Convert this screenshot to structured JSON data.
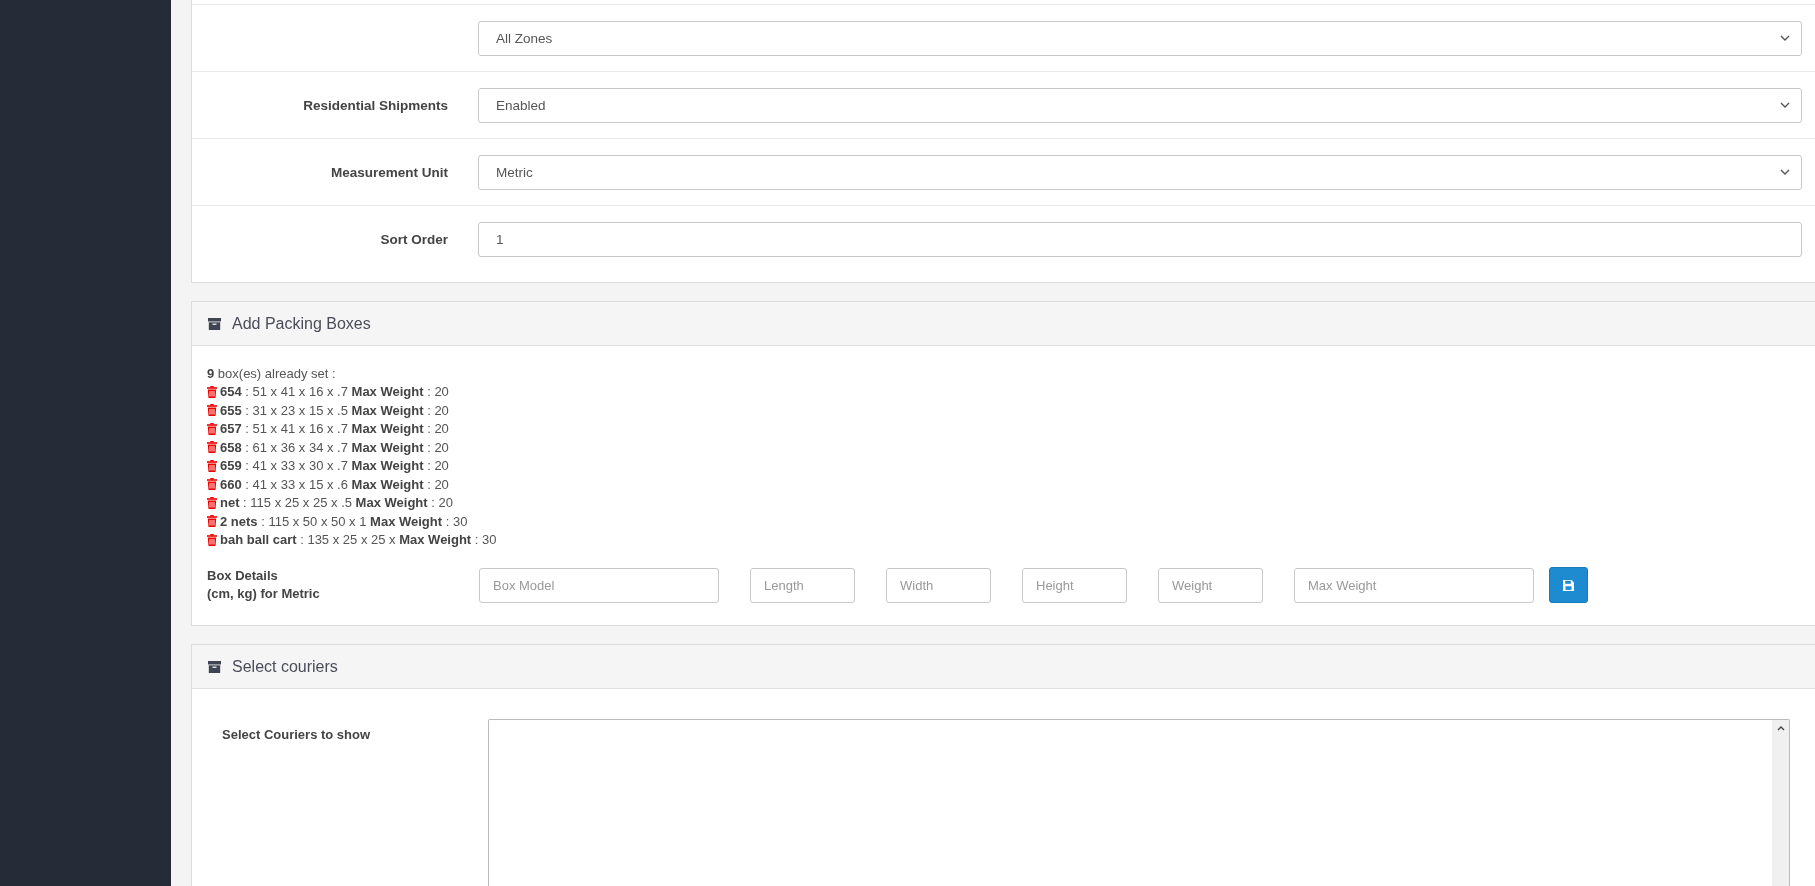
{
  "settings": [
    {
      "kind": "select",
      "value": "All Zones"
    },
    {
      "kind": "select",
      "label": "Residential Shipments",
      "value": "Enabled"
    },
    {
      "kind": "select",
      "label": "Measurement Unit",
      "value": "Metric"
    },
    {
      "kind": "text",
      "label": "Sort Order",
      "value": "1"
    }
  ],
  "packing_boxes": {
    "title": "Add Packing Boxes",
    "summary": "**9** box(es) already set :",
    "boxes": [
      "**654** : 51 x 41 x 16 x .7 **Max Weight** : 20",
      "**655** : 31 x 23 x 15 x .5 **Max Weight** : 20",
      "**657** : 51 x 41 x 16 x .7 **Max Weight** : 20",
      "**658** : 61 x 36 x 34 x .7 **Max Weight** : 20",
      "**659** : 41 x 33 x 30 x .7 **Max Weight** : 20",
      "**660** : 41 x 33 x 15 x .6 **Max Weight** : 20",
      "**net** : 115 x 25 x 25 x .5 **Max Weight** : 20",
      "**2 nets** : 115 x 50 x 50 x 1 **Max Weight** : 30",
      "**bah ball cart** : 135 x 25 x 25 x **Max Weight** : 30"
    ],
    "details_label": [
      "Box Details",
      "(cm, kg) for Metric"
    ],
    "inputs": [
      {
        "placeholder": "Box Model"
      },
      {
        "placeholder": "Length"
      },
      {
        "placeholder": "Width"
      },
      {
        "placeholder": "Height"
      },
      {
        "placeholder": "Weight"
      },
      {
        "placeholder": "Max Weight"
      }
    ]
  },
  "couriers": {
    "title": "Select couriers",
    "label": "Select Couriers to show"
  }
}
